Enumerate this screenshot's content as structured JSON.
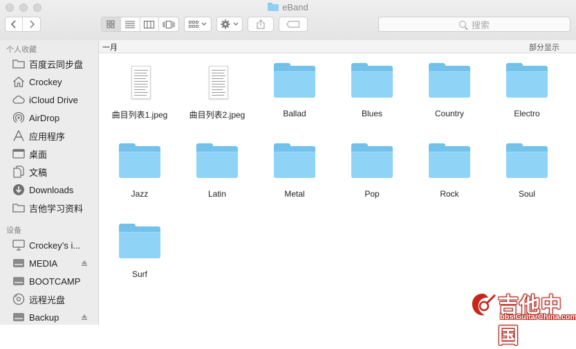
{
  "window": {
    "title": "eBand"
  },
  "toolbar": {
    "search_placeholder": "搜索",
    "view_modes": [
      "icon-view",
      "list-view",
      "column-view",
      "cover-flow-view"
    ],
    "active_view": "icon-view"
  },
  "sidebar": {
    "favorites_header": "个人收藏",
    "favorites": [
      {
        "label": "百度云同步盘",
        "icon": "folder-icon"
      },
      {
        "label": "Crockey",
        "icon": "home-icon"
      },
      {
        "label": "iCloud Drive",
        "icon": "cloud-icon"
      },
      {
        "label": "AirDrop",
        "icon": "airdrop-icon"
      },
      {
        "label": "应用程序",
        "icon": "applications-icon"
      },
      {
        "label": "桌面",
        "icon": "desktop-icon"
      },
      {
        "label": "文稿",
        "icon": "documents-icon"
      },
      {
        "label": "Downloads",
        "icon": "downloads-icon"
      },
      {
        "label": "吉他学习资料",
        "icon": "folder-icon"
      }
    ],
    "devices_header": "设备",
    "devices": [
      {
        "label": "Crockey’s i...",
        "icon": "computer-icon",
        "eject": false
      },
      {
        "label": "MEDIA",
        "icon": "drive-icon",
        "eject": true
      },
      {
        "label": "BOOTCAMP",
        "icon": "drive-icon",
        "eject": false
      },
      {
        "label": "远程光盘",
        "icon": "disc-icon",
        "eject": false
      },
      {
        "label": "Backup",
        "icon": "drive-icon",
        "eject": true
      }
    ]
  },
  "pathbar": {
    "group": "一月",
    "show_less": "部分显示"
  },
  "files": [
    {
      "name": "曲目列表1.jpeg",
      "kind": "image"
    },
    {
      "name": "曲目列表2.jpeg",
      "kind": "image"
    },
    {
      "name": "Ballad",
      "kind": "folder"
    },
    {
      "name": "Blues",
      "kind": "folder"
    },
    {
      "name": "Country",
      "kind": "folder"
    },
    {
      "name": "Electro",
      "kind": "folder"
    },
    {
      "name": "Jazz",
      "kind": "folder"
    },
    {
      "name": "Latin",
      "kind": "folder"
    },
    {
      "name": "Metal",
      "kind": "folder"
    },
    {
      "name": "Pop",
      "kind": "folder"
    },
    {
      "name": "Rock",
      "kind": "folder"
    },
    {
      "name": "Soul",
      "kind": "folder"
    },
    {
      "name": "Surf",
      "kind": "folder"
    }
  ],
  "watermark": {
    "title": "吉他中国",
    "url": "bbs.GuitarChina.com"
  },
  "colors": {
    "folder": "#8fd3f6",
    "sidebar_bg": "#ececec",
    "watermark_red": "#b5261c"
  }
}
